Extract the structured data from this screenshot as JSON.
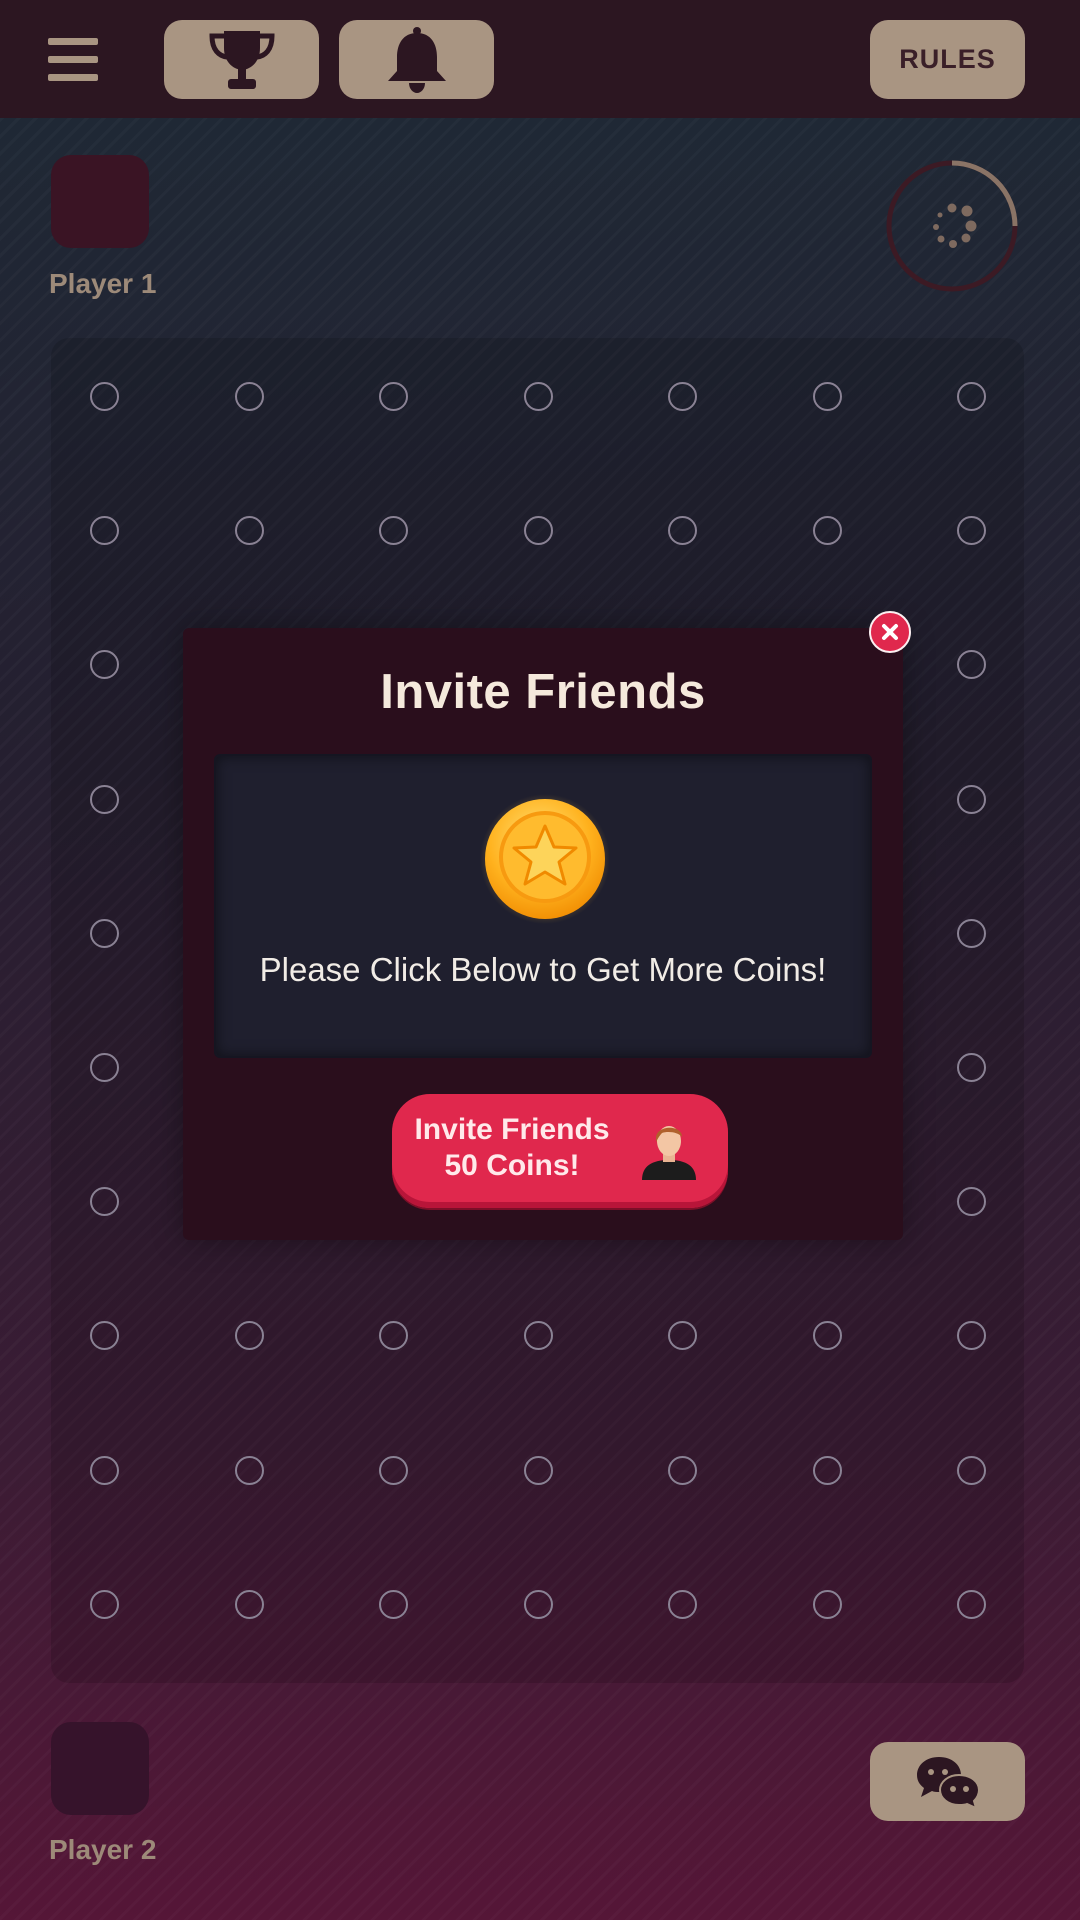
{
  "header": {
    "menu_icon": "hamburger-menu-icon",
    "trophy_icon": "trophy-icon",
    "bell_icon": "bell-icon",
    "rules_label": "RULES",
    "button_color": "#a99582"
  },
  "players": {
    "player1": {
      "name": "Player 1"
    },
    "player2": {
      "name": "Player 2"
    }
  },
  "timer": {
    "icon": "loading-spinner-icon"
  },
  "board": {
    "rows": 10,
    "columns": 7,
    "dot_icon": "empty-dot-icon"
  },
  "modal": {
    "title": "Invite Friends",
    "coin_icon": "gold-star-coin-icon",
    "message": "Please Click Below to Get More Coins!",
    "button_line1": "Invite Friends",
    "button_line2": "50 Coins!",
    "button_icon": "person-avatar-icon",
    "close_icon": "close-x-icon",
    "accent_color": "#e0284d"
  },
  "chat": {
    "icon": "chat-bubbles-icon"
  }
}
